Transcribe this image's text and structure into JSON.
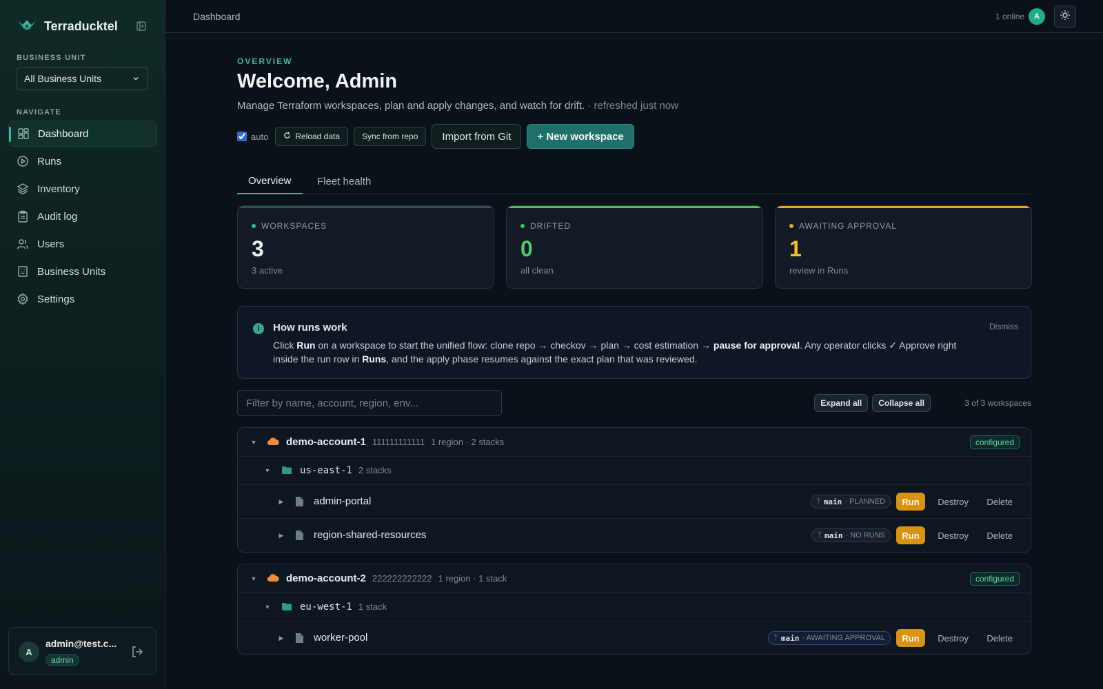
{
  "app": {
    "name": "Terraducktel"
  },
  "sidebar": {
    "business_unit_label": "BUSINESS UNIT",
    "business_unit_value": "All Business Units",
    "navigate_label": "NAVIGATE",
    "items": [
      {
        "label": "Dashboard",
        "icon": "dashboard-icon",
        "active": true
      },
      {
        "label": "Runs",
        "icon": "play-circle-icon"
      },
      {
        "label": "Inventory",
        "icon": "layers-icon"
      },
      {
        "label": "Audit log",
        "icon": "clipboard-icon"
      },
      {
        "label": "Users",
        "icon": "users-icon"
      },
      {
        "label": "Business Units",
        "icon": "building-icon"
      },
      {
        "label": "Settings",
        "icon": "gear-icon"
      }
    ],
    "user": {
      "initial": "A",
      "email": "admin@test.c...",
      "role": "admin"
    }
  },
  "topbar": {
    "breadcrumb": "Dashboard",
    "online": "1 online",
    "avatar_initial": "A"
  },
  "header": {
    "eyebrow": "OVERVIEW",
    "title": "Welcome, Admin",
    "subtitle": "Manage Terraform workspaces, plan and apply changes, and watch for drift.",
    "refreshed": "· refreshed just now"
  },
  "actions": {
    "auto_label": "auto",
    "reload": "Reload data",
    "sync": "Sync from repo",
    "import": "Import from Git",
    "new_workspace": "+ New workspace"
  },
  "tabs": [
    "Overview",
    "Fleet health"
  ],
  "stats": [
    {
      "label": "WORKSPACES",
      "value": "3",
      "sub": "3 active",
      "color": "#3fb59a"
    },
    {
      "label": "DRIFTED",
      "value": "0",
      "sub": "all clean",
      "color": "#4cc35a"
    },
    {
      "label": "AWAITING APPROVAL",
      "value": "1",
      "sub": "review in Runs",
      "color": "#f2a428"
    }
  ],
  "info": {
    "title": "How runs work",
    "dismiss": "Dismiss",
    "p1": "Click ",
    "b1": "Run",
    "p2": " on a workspace to start the unified flow: clone repo → checkov → plan → cost estimation → ",
    "b2": "pause for approval",
    "p3": ". Any operator clicks ✓ Approve right inside the run row in ",
    "b3": "Runs",
    "p4": ", and the apply phase resumes against the exact plan that was reviewed."
  },
  "list": {
    "filter_placeholder": "Filter by name, account, region, env...",
    "expand_all": "Expand all",
    "collapse_all": "Collapse all",
    "count": "3 of 3 workspaces",
    "run_label": "Run",
    "destroy_label": "Destroy",
    "delete_label": "Delete",
    "accounts": [
      {
        "name": "demo-account-1",
        "id": "111111111111",
        "meta": "1 region · 2 stacks",
        "badge": "configured",
        "region": {
          "name": "us-east-1",
          "meta": "2 stacks"
        },
        "stacks": [
          {
            "name": "admin-portal",
            "branch": "main",
            "status": "· PLANNED"
          },
          {
            "name": "region-shared-resources",
            "branch": "main",
            "status": "· NO RUNS"
          }
        ]
      },
      {
        "name": "demo-account-2",
        "id": "222222222222",
        "meta": "1 region · 1 stack",
        "badge": "configured",
        "region": {
          "name": "eu-west-1",
          "meta": "1 stack"
        },
        "stacks": [
          {
            "name": "worker-pool",
            "branch": "main",
            "status": "· AWAITING APPROVAL"
          }
        ]
      }
    ]
  }
}
